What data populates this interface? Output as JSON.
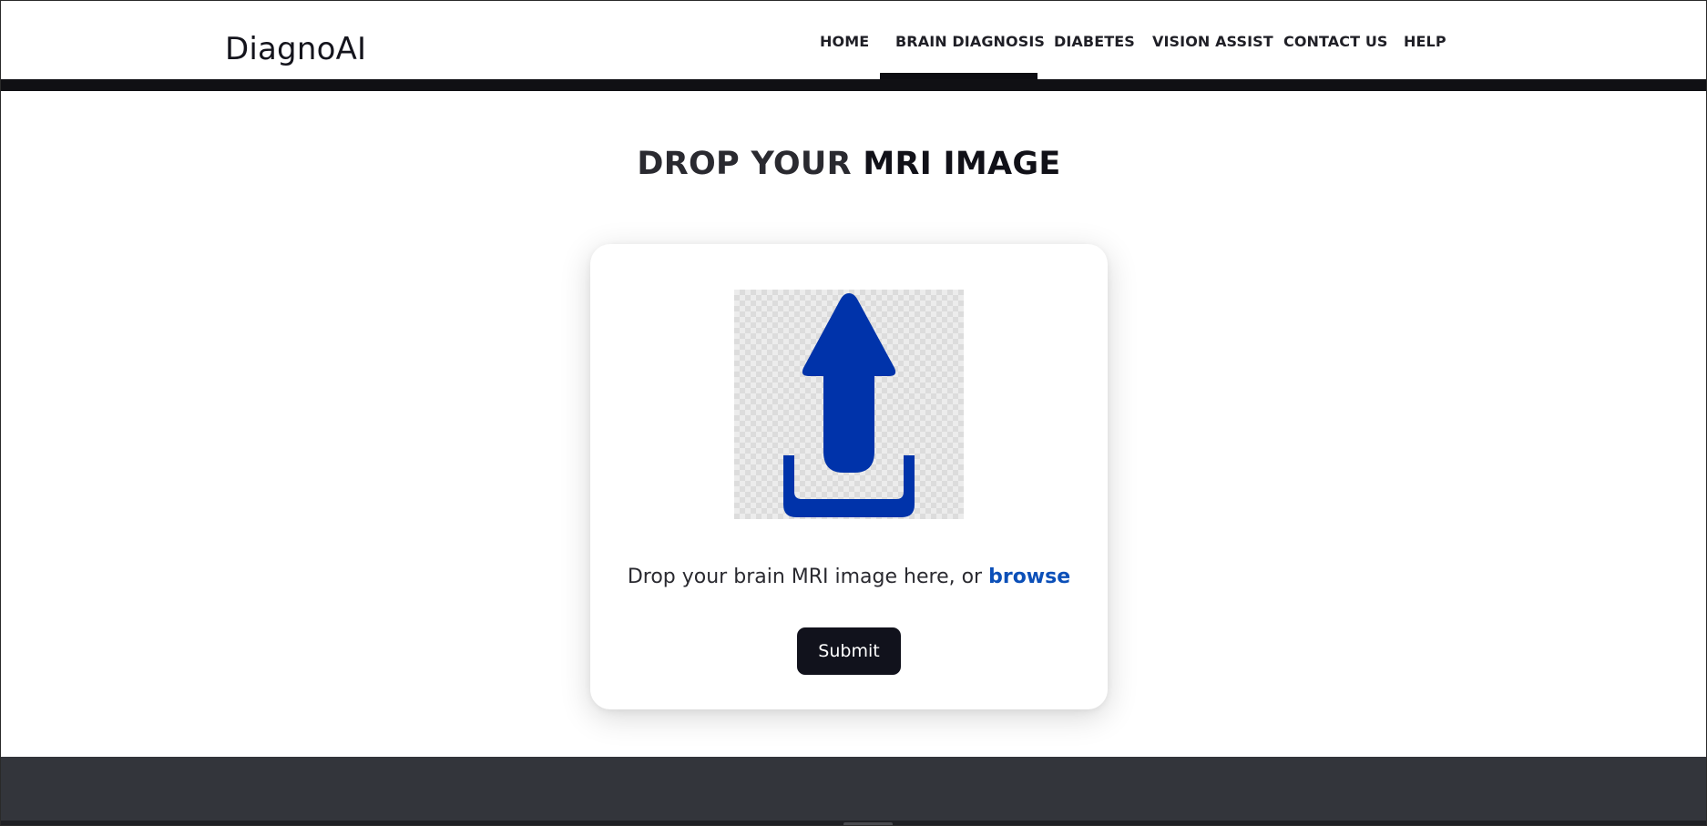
{
  "brand": {
    "name": "DiagnoAI"
  },
  "nav": {
    "items": [
      {
        "label": "HOME",
        "active": false
      },
      {
        "label": "BRAIN DIAGNOSIS",
        "active": true
      },
      {
        "label": "DIABETES",
        "active": false
      },
      {
        "label": "VISION ASSIST",
        "active": false
      },
      {
        "label": "CONTACT US",
        "active": false
      },
      {
        "label": "HELP",
        "active": false
      }
    ]
  },
  "main": {
    "title_part1": "DROP YOUR ",
    "title_part2": "MRI IMAGE",
    "upload": {
      "icon": "upload-arrow-icon",
      "prompt": "Drop your brain MRI image here, or ",
      "browse_label": "browse",
      "submit_label": "Submit"
    }
  },
  "colors": {
    "accent_blue": "#0033aa",
    "link_blue": "#0b4fb8",
    "dark": "#11121c",
    "footer": "#33353b"
  }
}
